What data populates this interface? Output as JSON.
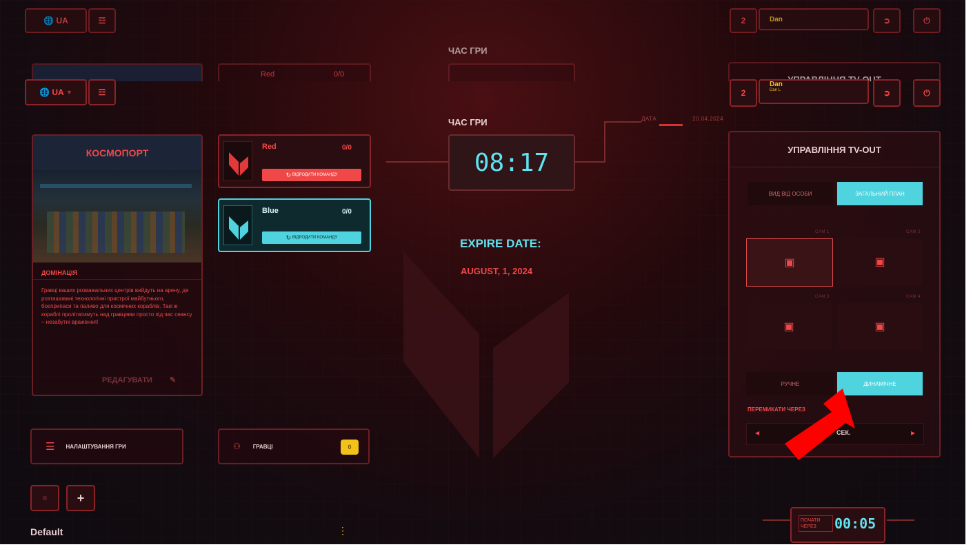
{
  "header": {
    "language": "UA",
    "players_count": "2",
    "user_name": "Dan",
    "user_sub": "Dan L",
    "date_label": "ДАТА",
    "date_value": "20.04.2024"
  },
  "ghost": {
    "game_time_label": "ЧАС ГРИ",
    "team_red": "Red",
    "team_red_score": "0/0",
    "tvout_title": "УПРАВЛІННЯ TV-OUT"
  },
  "location": {
    "title": "КОСМОПОРТ",
    "mode": "ДОМІНАЦІЯ",
    "description": "Гравці ваших розважальних центрів вийдуть на арену, де розташовані технологічні пристрої майбутнього, боєприпаси та паливо для космічних кораблів. Такі ж кораблі пролітатимуть над гравцями просто під час сеансу – незабутні враження!",
    "edit_label": "РЕДАГУВАТИ"
  },
  "teams": [
    {
      "name": "Red",
      "score": "0/0",
      "revive_label": "ВІДРОДИТИ КОМАНДУ"
    },
    {
      "name": "Blue",
      "score": "0/0",
      "revive_label": "ВІДРОДИТИ КОМАНДУ"
    }
  ],
  "game": {
    "time_label": "ЧАС ГРИ",
    "time_value": "08:17",
    "expire_label": "EXPIRE DATE:",
    "expire_value": "AUGUST, 1, 2024"
  },
  "tvout": {
    "title": "УПРАВЛІННЯ TV-OUT",
    "view_first_person": "ВИД ВІД ОСОБИ",
    "view_general": "ЗАГАЛЬНИЙ ПЛАН",
    "cams": [
      "CAM 1",
      "CAM 2",
      "CAM 3",
      "CAM 4"
    ],
    "mode_manual": "РУЧНЕ",
    "mode_dynamic": "ДИНАМІЧНЕ",
    "switch_label": "ПЕРЕМИКАТИ ЧЕРЕЗ",
    "switch_value": "СЕК."
  },
  "bottom": {
    "settings_label": "НАЛАШТУВАННЯ ГРИ",
    "players_label": "ГРАВЦІ",
    "players_count": "0",
    "preset_name": "Default",
    "start_label": "ПОЧАТИ ЧЕРЕЗ",
    "start_value": "00:05"
  },
  "colors": {
    "accent_red": "#f04848",
    "accent_cyan": "#5fe3ef",
    "badge_yellow": "#f2c21b",
    "arrow_red": "#ff0000"
  }
}
